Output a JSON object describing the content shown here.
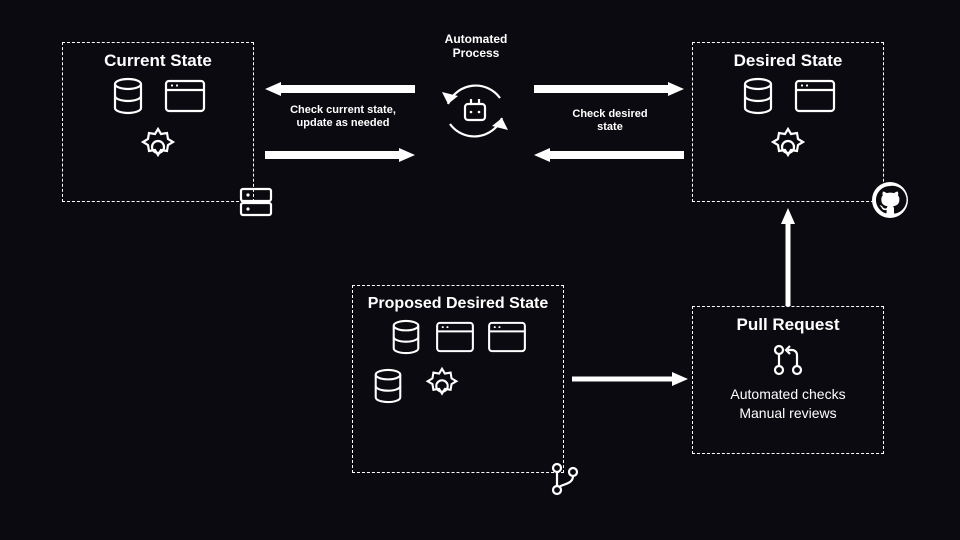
{
  "boxes": {
    "current_state": {
      "title": "Current State"
    },
    "desired_state": {
      "title": "Desired State"
    },
    "proposed_desired_state": {
      "title": "Proposed Desired State"
    },
    "pull_request": {
      "title": "Pull Request",
      "sub1": "Automated checks",
      "sub2": "Manual reviews"
    }
  },
  "center": {
    "label_top": "Automated Process"
  },
  "arrows": {
    "check_current": "Check current state, update as needed",
    "check_desired": "Check desired state"
  }
}
